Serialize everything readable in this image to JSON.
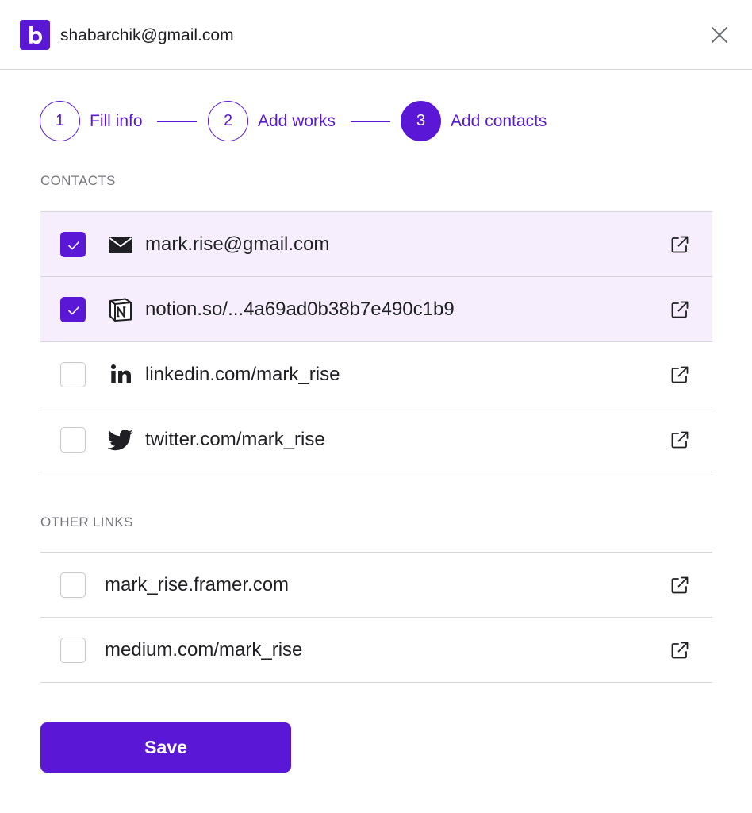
{
  "header": {
    "logo_letter": "b",
    "account_email": "shabarchik@gmail.com"
  },
  "stepper": {
    "steps": [
      {
        "number": "1",
        "label": "Fill info",
        "active": false
      },
      {
        "number": "2",
        "label": "Add works",
        "active": false
      },
      {
        "number": "3",
        "label": "Add contacts",
        "active": true
      }
    ]
  },
  "contacts": {
    "title": "CONTACTS",
    "items": [
      {
        "label": "mark.rise@gmail.com",
        "icon": "mail-icon",
        "checked": true
      },
      {
        "label": "notion.so/...4a69ad0b38b7e490c1b9",
        "icon": "notion-icon",
        "checked": true
      },
      {
        "label": "linkedin.com/mark_rise",
        "icon": "linkedin-icon",
        "checked": false
      },
      {
        "label": "twitter.com/mark_rise",
        "icon": "twitter-icon",
        "checked": false
      }
    ]
  },
  "other_links": {
    "title": "OTHER LINKS",
    "items": [
      {
        "label": "mark_rise.framer.com",
        "checked": false
      },
      {
        "label": "medium.com/mark_rise",
        "checked": false
      }
    ]
  },
  "save_label": "Save",
  "colors": {
    "accent": "#5a17d6",
    "checked_row_bg": "#f6eefc",
    "divider": "#d6d6da"
  }
}
